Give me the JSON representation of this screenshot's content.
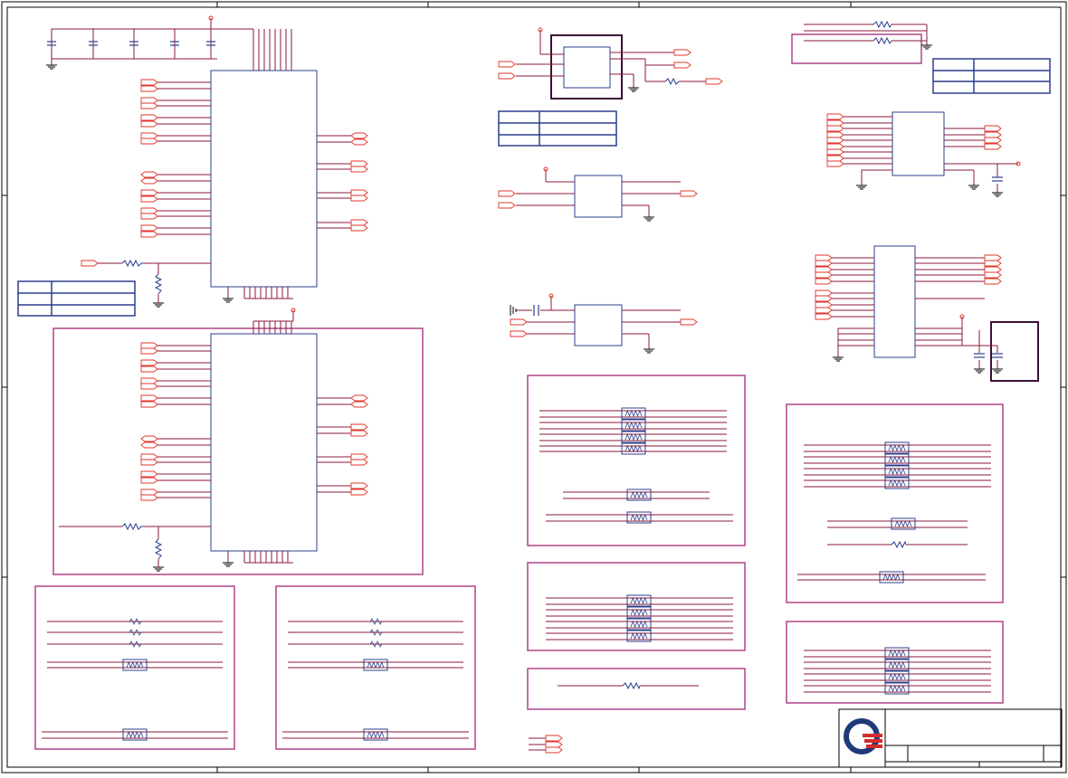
{
  "colors": {
    "wire": "#8b1a3a",
    "port": "#e0352b",
    "box": "#2b3f8f",
    "section": "#b0428a",
    "frame": "#000000",
    "logo_blue": "#1f3a7a",
    "logo_red": "#d62b2b"
  },
  "icons": {
    "logo": "quanta-logo-icon",
    "ground": "ground-symbol-icon",
    "resistor": "resistor-icon",
    "resistor_pack": "resistor-pack-icon",
    "capacitor": "capacitor-icon",
    "port": "net-port-icon"
  },
  "title_block": {
    "title_text": "",
    "size_text": "",
    "doc_text": "",
    "rev_text": ""
  }
}
